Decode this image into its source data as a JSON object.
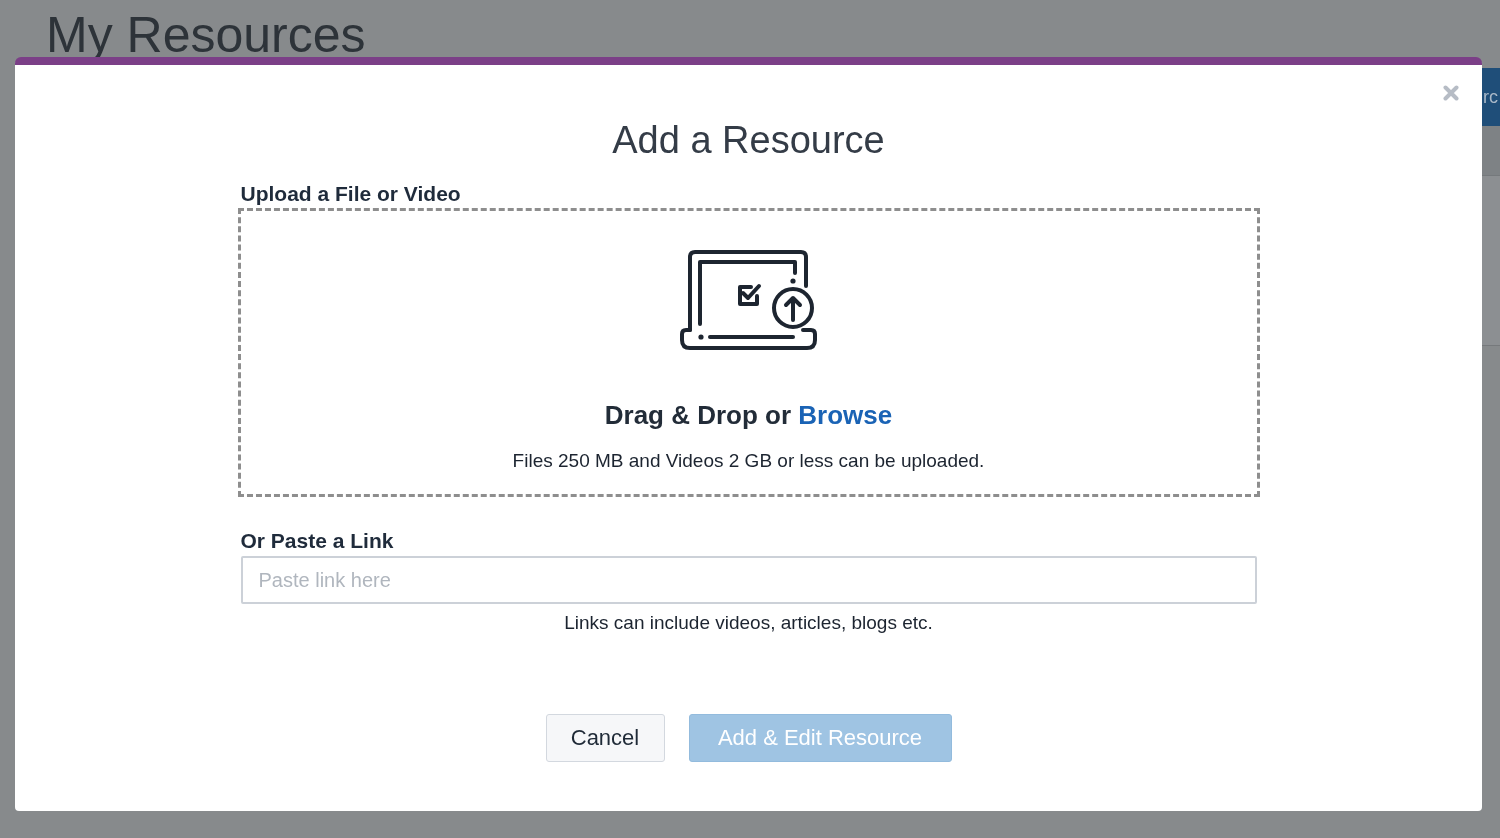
{
  "background": {
    "page_title": "My Resources",
    "header_button": {
      "label": "rc"
    }
  },
  "modal": {
    "title": "Add a Resource",
    "upload": {
      "label": "Upload a File or Video",
      "prompt": "Drag & Drop or",
      "link": "Browse",
      "note": "Files 250 MB and Videos 2 GB or less can be uploaded."
    },
    "link_field": {
      "label": "Or Paste a Link",
      "placeholder": "Paste link here",
      "hint": "Links can include videos, articles, blogs etc."
    },
    "buttons": [
      {
        "label": "Cancel",
        "kind": "secondary",
        "disabled": false
      },
      {
        "label": "Add & Edit Resource",
        "kind": "primary",
        "disabled": true
      }
    ]
  }
}
